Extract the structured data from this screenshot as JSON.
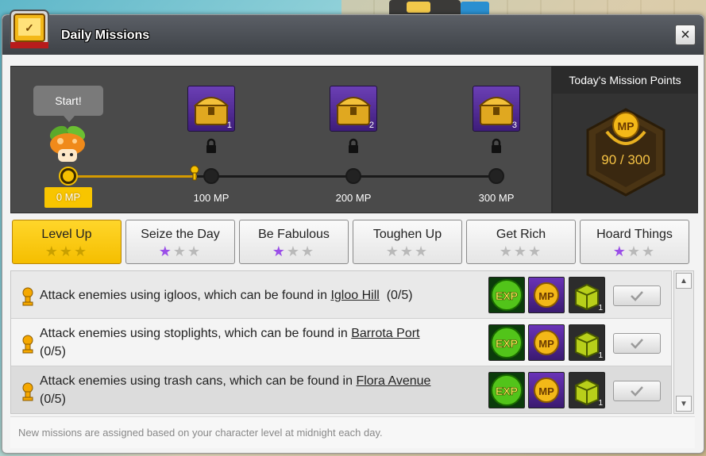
{
  "window": {
    "title": "Daily Missions",
    "close_icon": "×"
  },
  "progress": {
    "start_label": "Start!",
    "current_label": "0 MP",
    "milestones": [
      {
        "label": "100 MP",
        "chest_number": "1"
      },
      {
        "label": "200 MP",
        "chest_number": "2"
      },
      {
        "label": "300 MP",
        "chest_number": "3"
      }
    ]
  },
  "points": {
    "header": "Today's Mission Points",
    "value": "90 / 300",
    "emblem_text": "MP"
  },
  "tabs": [
    {
      "label": "Level Up",
      "stars": 0,
      "active": true
    },
    {
      "label": "Seize the Day",
      "stars": 1,
      "active": false
    },
    {
      "label": "Be Fabulous",
      "stars": 1,
      "active": false
    },
    {
      "label": "Toughen Up",
      "stars": 0,
      "active": false
    },
    {
      "label": "Get Rich",
      "stars": 0,
      "active": false
    },
    {
      "label": "Hoard Things",
      "stars": 1,
      "active": false
    }
  ],
  "missions": [
    {
      "text": "Attack enemies using igloos, which can be found in ",
      "location": "Igloo Hill",
      "progress": "(0/5)",
      "box_count": "1"
    },
    {
      "text": "Attack enemies using stoplights, which can be found in ",
      "location": "Barrota Port",
      "progress": "(0/5)",
      "box_count": "1"
    },
    {
      "text": "Attack enemies using trash cans, which can be found in ",
      "location": "Flora Avenue",
      "progress": "(0/5)",
      "box_count": "1"
    }
  ],
  "rewards": {
    "exp_label": "EXP",
    "mp_label": "MP"
  },
  "footer": "New missions are assigned based on your character level at midnight each day.",
  "colors": {
    "accent": "#f5be00",
    "purple": "#9a4ee8"
  }
}
